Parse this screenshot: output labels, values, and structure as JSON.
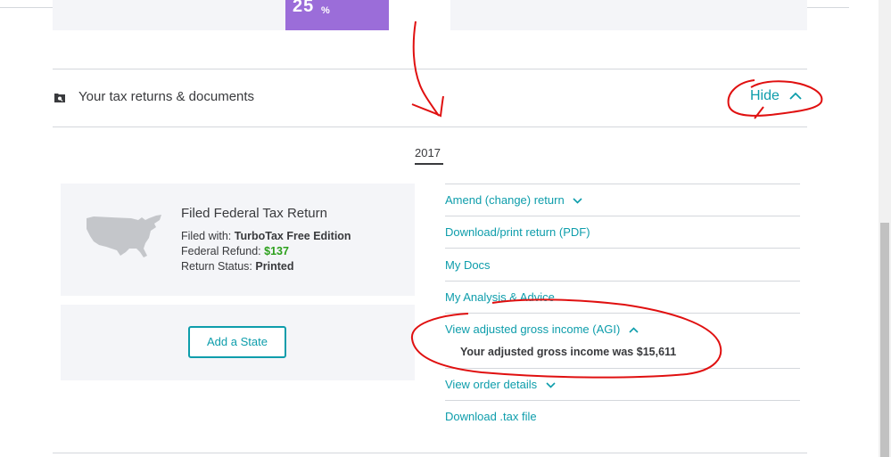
{
  "top_banner": {
    "promo_value": "25",
    "promo_unit": "%"
  },
  "section": {
    "title": "Your tax returns & documents",
    "toggle_label": "Hide"
  },
  "tabs": [
    {
      "label": "2017",
      "selected": true
    }
  ],
  "federal_card": {
    "title": "Filed Federal Tax Return",
    "filed_with_label": "Filed with:",
    "filed_with_value": "TurboTax Free Edition",
    "refund_label": "Federal Refund:",
    "refund_value": "$137",
    "status_label": "Return Status:",
    "status_value": "Printed"
  },
  "state_card": {
    "add_state_label": "Add a State"
  },
  "actions": {
    "amend": "Amend (change) return",
    "download_pdf": "Download/print return (PDF)",
    "my_docs": "My Docs",
    "analysis": "My Analysis & Advice",
    "view_agi": "View adjusted gross income (AGI)",
    "agi_result": "Your adjusted gross income was $15,611",
    "order_details": "View order details",
    "download_tax": "Download .tax file"
  },
  "colors": {
    "link": "#0d9dab",
    "refund_green": "#2ca01c",
    "card_bg": "#f4f5f8",
    "annotation_red": "#e01010",
    "promo_purple": "#9b6dd9"
  }
}
